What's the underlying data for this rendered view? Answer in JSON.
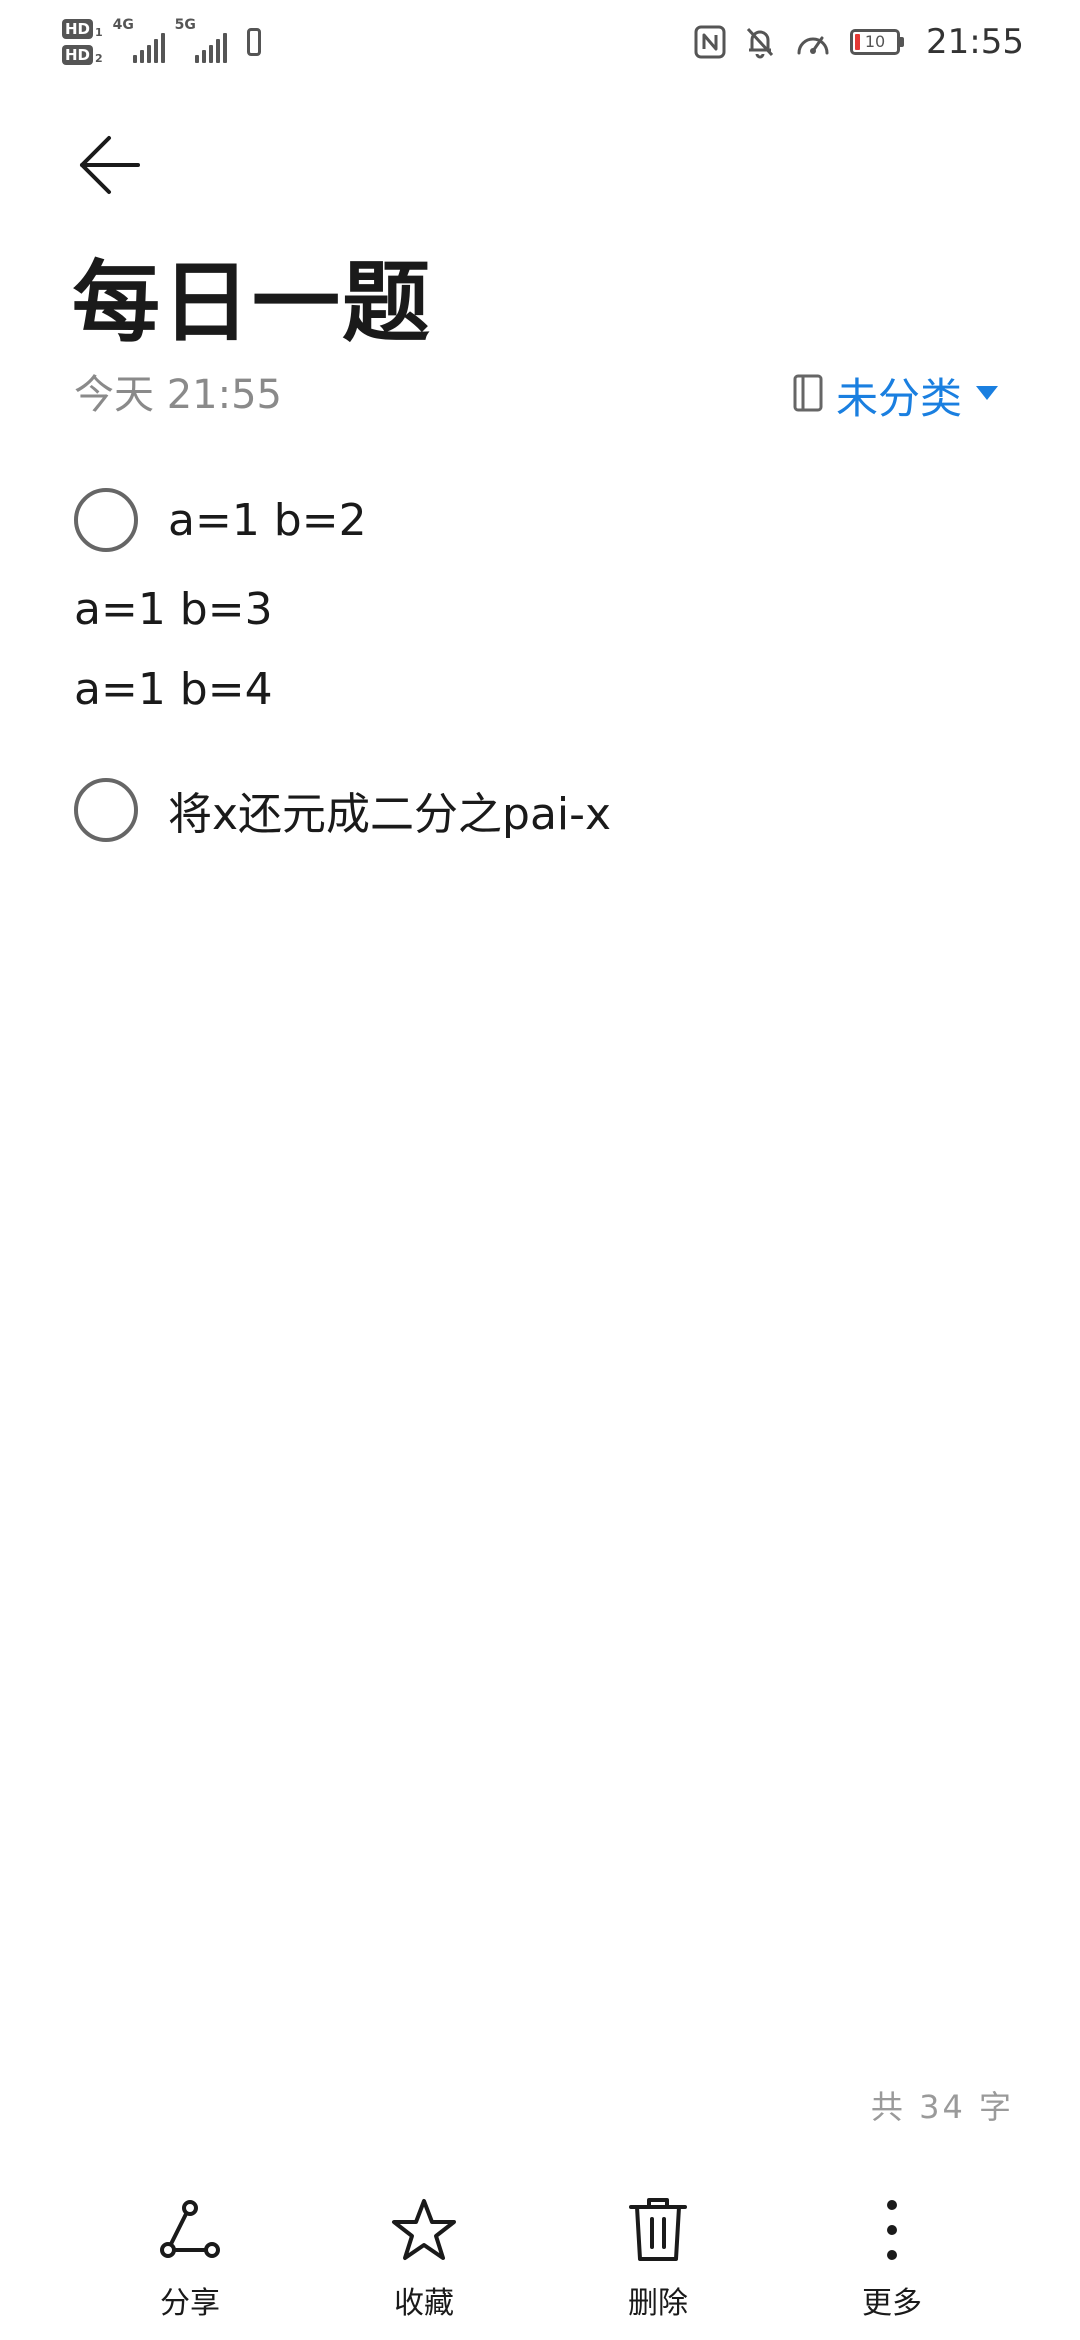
{
  "status_bar": {
    "sim1_badge": "HD",
    "sim1_num": "1",
    "sim2_badge": "HD",
    "sim2_num": "2",
    "network1": "4G",
    "network2": "5G",
    "battery_level": "10",
    "time": "21:55",
    "icons": [
      "nfc-icon",
      "mute-bell-icon",
      "speedometer-icon",
      "battery-icon"
    ]
  },
  "header": {
    "back_icon": "arrow-left-icon",
    "title": "每日一题",
    "time": "今天 21:55",
    "category": {
      "icon": "notebook-icon",
      "label": "未分类",
      "caret_icon": "caret-down-icon",
      "color": "#1a7fe0"
    }
  },
  "content": {
    "lines": [
      {
        "type": "todo",
        "checked": false,
        "text": "a=1 b=2"
      },
      {
        "type": "text",
        "text": "a=1 b=3"
      },
      {
        "type": "text",
        "text": "a=1 b=4"
      },
      {
        "type": "todo",
        "checked": false,
        "text": "将x还元成二分之pai-x"
      }
    ]
  },
  "footer": {
    "word_count": "共 34 字",
    "actions": [
      {
        "label": "分享",
        "icon": "share-icon"
      },
      {
        "label": "收藏",
        "icon": "star-icon"
      },
      {
        "label": "删除",
        "icon": "trash-icon"
      },
      {
        "label": "更多",
        "icon": "more-vertical-icon"
      }
    ]
  }
}
